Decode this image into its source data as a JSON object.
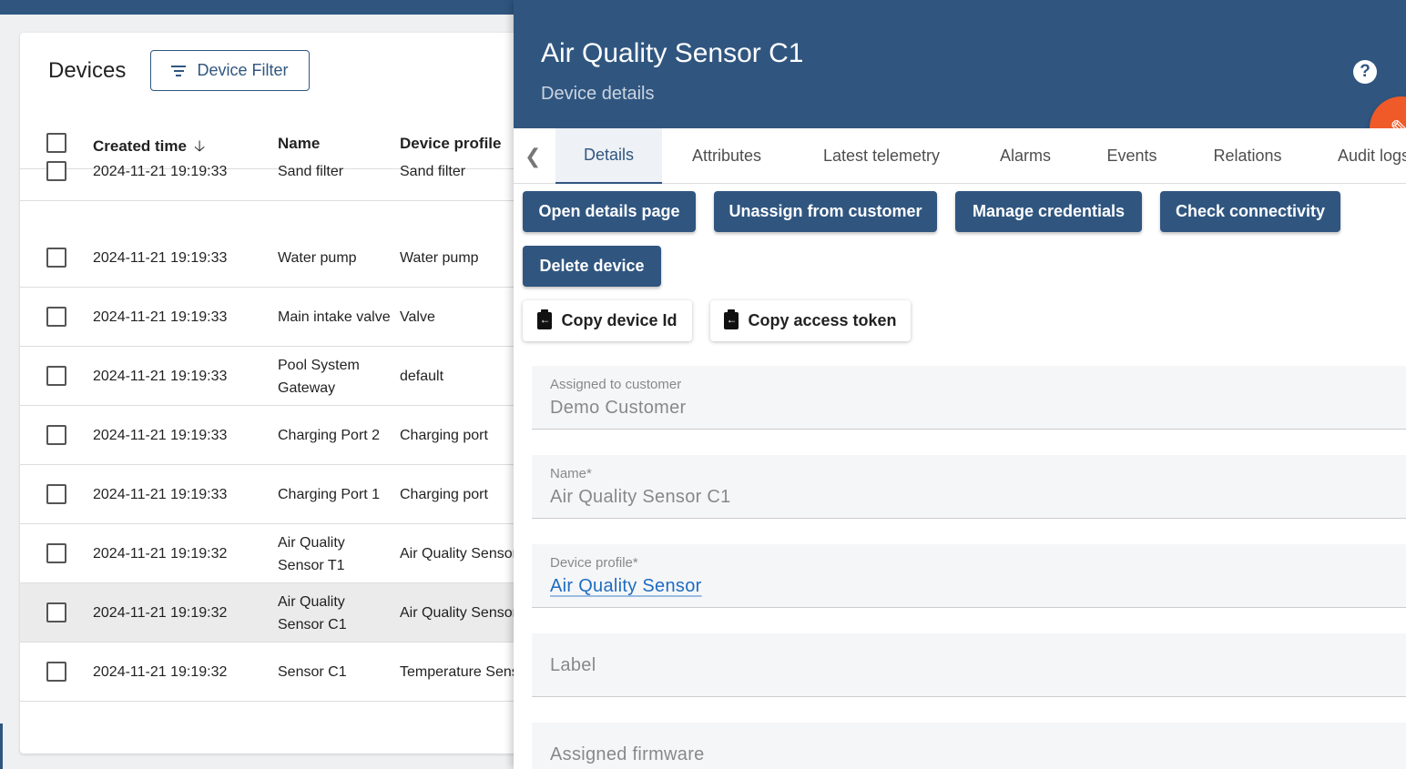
{
  "devices": {
    "title": "Devices",
    "filter_label": "Device Filter",
    "columns": {
      "created": "Created time",
      "name": "Name",
      "profile": "Device profile"
    },
    "rows": [
      {
        "created": "2024-11-21 19:19:33",
        "name": "Sand filter",
        "profile": "Sand filter"
      },
      {
        "created": "2024-11-21 19:19:33",
        "name": "Water pump",
        "profile": "Water pump"
      },
      {
        "created": "2024-11-21 19:19:33",
        "name": "Main intake valve",
        "profile": "Valve"
      },
      {
        "created": "2024-11-21 19:19:33",
        "name": "Pool System Gateway",
        "profile": "default"
      },
      {
        "created": "2024-11-21 19:19:33",
        "name": "Charging Port 2",
        "profile": "Charging port"
      },
      {
        "created": "2024-11-21 19:19:33",
        "name": "Charging Port 1",
        "profile": "Charging port"
      },
      {
        "created": "2024-11-21 19:19:32",
        "name": "Air Quality Sensor T1",
        "profile": "Air Quality Sensor"
      },
      {
        "created": "2024-11-21 19:19:32",
        "name": "Air Quality Sensor C1",
        "profile": "Air Quality Sensor",
        "selected": true
      },
      {
        "created": "2024-11-21 19:19:32",
        "name": "Sensor C1",
        "profile": "Temperature Sensor"
      }
    ]
  },
  "details": {
    "title": "Air Quality Sensor C1",
    "subtitle": "Device details",
    "tabs": [
      "Details",
      "Attributes",
      "Latest telemetry",
      "Alarms",
      "Events",
      "Relations",
      "Audit logs"
    ],
    "active_tab": "Details",
    "actions": {
      "open_details": "Open details page",
      "unassign": "Unassign from customer",
      "manage_credentials": "Manage credentials",
      "check_connectivity": "Check connectivity",
      "delete": "Delete device",
      "copy_id": "Copy device Id",
      "copy_token": "Copy access token"
    },
    "fields": {
      "customer_label": "Assigned to customer",
      "customer_value": "Demo Customer",
      "name_label": "Name*",
      "name_value": "Air Quality Sensor C1",
      "profile_label": "Device profile*",
      "profile_value": "Air Quality Sensor",
      "label_placeholder": "Label",
      "firmware_placeholder": "Assigned firmware"
    }
  },
  "colors": {
    "primary": "#305680",
    "accent": "#f05a28",
    "link": "#1e6cc0"
  },
  "icons": {
    "filter": "filter-list-icon",
    "sort": "arrow-down-icon",
    "help": "help-icon",
    "edit": "pencil-icon",
    "copy": "clipboard-icon",
    "tab_back": "chevron-left-icon"
  }
}
